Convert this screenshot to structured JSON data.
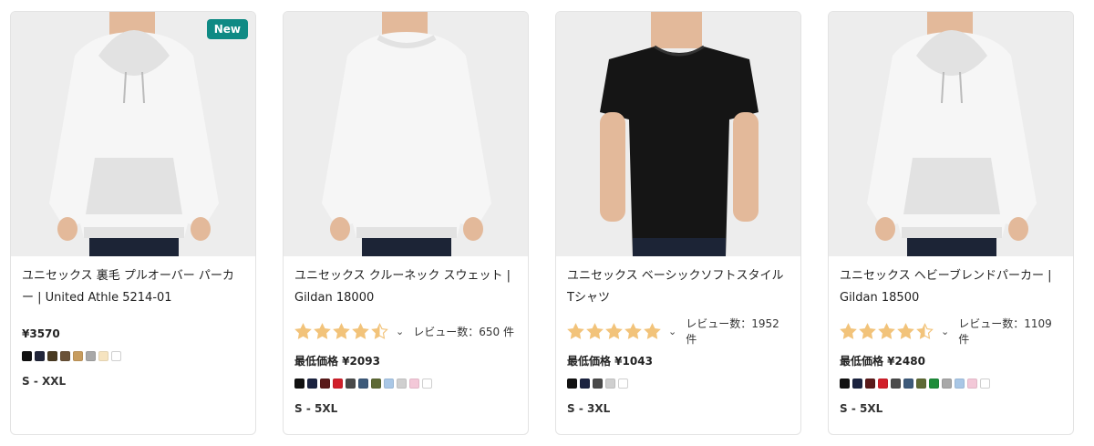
{
  "products": [
    {
      "badge": "New",
      "garment": "hoodie",
      "garment_color": "#f6f6f6",
      "title": "ユニセックス 裏毛 プルオーバー パーカー | United Athle 5214-01",
      "price": "¥3570",
      "price_prefix": "",
      "sizes": "S - XXL",
      "swatches": [
        "#111111",
        "#22263a",
        "#4a3b22",
        "#6a5238",
        "#c79c5e",
        "#a8a8a8",
        "#f6e4c0",
        "#ffffff"
      ]
    },
    {
      "badge": "",
      "garment": "sweatshirt",
      "garment_color": "#f6f6f6",
      "title": "ユニセックス クルーネック スウェット | Gildan 18000",
      "rating": 4.5,
      "reviews_label": "レビュー数：650 件",
      "price": "最低価格 ¥2093",
      "sizes": "S - 5XL",
      "swatches": [
        "#111111",
        "#1b2340",
        "#5a1a1a",
        "#d11f2a",
        "#4a4a4a",
        "#3d5a7a",
        "#5e6a35",
        "#a9c7e6",
        "#cfcfcf",
        "#f3c8d8",
        "#ffffff"
      ]
    },
    {
      "badge": "",
      "garment": "tshirt",
      "garment_color": "#151515",
      "title": "ユニセックス ベーシックソフトスタイル Tシャツ",
      "rating": 5,
      "reviews_label": "レビュー数：1952 件",
      "price": "最低価格 ¥1043",
      "sizes": "S - 3XL",
      "swatches": [
        "#111111",
        "#1b2340",
        "#4a4a4a",
        "#cfcfcf",
        "#ffffff"
      ]
    },
    {
      "badge": "",
      "garment": "hoodie",
      "garment_color": "#f6f6f6",
      "title": "ユニセックス ヘビーブレンドパーカー | Gildan 18500",
      "rating": 4.5,
      "reviews_label": "レビュー数：1109 件",
      "price": "最低価格 ¥2480",
      "sizes": "S - 5XL",
      "swatches": [
        "#111111",
        "#1b2340",
        "#5a1a1a",
        "#d11f2a",
        "#4a4a4a",
        "#3d5a7a",
        "#5e6a35",
        "#1e8c3a",
        "#a8a8a8",
        "#a9c7e6",
        "#f3c8d8",
        "#ffffff"
      ]
    }
  ],
  "colors": {
    "star": "#f2c37a",
    "star_empty": "#e6e6e6",
    "badge": "#0f8a84"
  }
}
